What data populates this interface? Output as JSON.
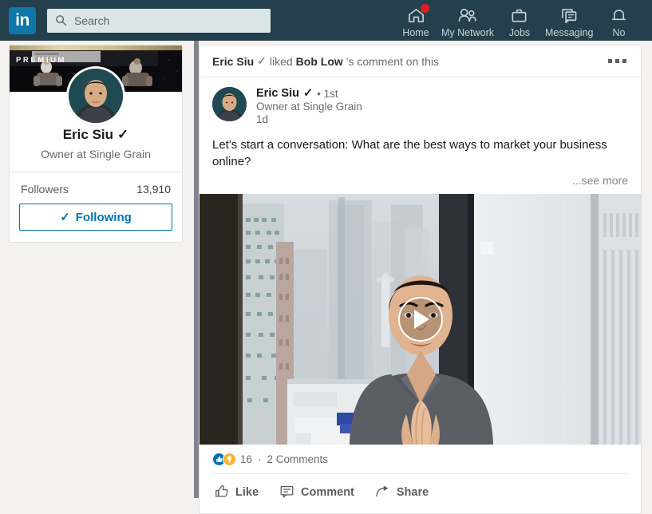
{
  "nav": {
    "logo_text": "in",
    "search_placeholder": "Search",
    "items": [
      {
        "label": "Home",
        "icon": "home-icon",
        "badge": true
      },
      {
        "label": "My Network",
        "icon": "people-icon",
        "badge": false
      },
      {
        "label": "Jobs",
        "icon": "briefcase-icon",
        "badge": false
      },
      {
        "label": "Messaging",
        "icon": "message-icon",
        "badge": false
      },
      {
        "label": "No",
        "icon": "bell-icon",
        "badge": false
      }
    ]
  },
  "sidebar": {
    "premium_label": "PREMIUM",
    "name": "Eric Siu",
    "verified": "✓",
    "headline": "Owner at Single Grain",
    "followers_label": "Followers",
    "followers_count": "13,910",
    "follow_button": "Following",
    "follow_check": "✓"
  },
  "post": {
    "context": {
      "actor": "Eric Siu",
      "actor_verified": "✓",
      "verb": "liked",
      "target": "Bob Low",
      "suffix": "'s comment on this"
    },
    "author": {
      "name": "Eric Siu",
      "verified": "✓",
      "degree": "• 1st",
      "headline": "Owner at Single Grain",
      "time": "1d"
    },
    "body": "Let's start a conversation: What are the best ways to market your business online?",
    "see_more": "...see more",
    "video": {
      "play_label": "play-button"
    },
    "social": {
      "reaction_count": "16",
      "separator": "·",
      "comments": "2 Comments"
    },
    "actions": [
      {
        "label": "Like",
        "icon": "thumbs-up-icon"
      },
      {
        "label": "Comment",
        "icon": "comment-bubble-icon"
      },
      {
        "label": "Share",
        "icon": "share-arrow-icon"
      }
    ]
  },
  "colors": {
    "nav_bg": "#24404d",
    "brand_blue": "#0073b1",
    "logo_blue": "#0e76a8",
    "badge_red": "#e02020",
    "reaction_like": "#0073b1",
    "reaction_insight": "#f5b335",
    "page_bg": "#f3f2f0"
  }
}
